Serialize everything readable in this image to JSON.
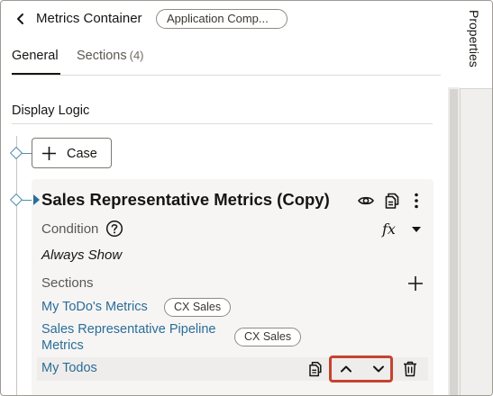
{
  "header": {
    "back_icon": "chevron-left-icon",
    "title": "Metrics Container",
    "type_badge": "Application Comp..."
  },
  "tabs": [
    {
      "label": "General",
      "selected": true
    },
    {
      "label": "Sections",
      "count": "(4)",
      "selected": false
    }
  ],
  "side_panel": {
    "tab_label": "Properties"
  },
  "display_logic": {
    "heading": "Display Logic",
    "add_case_label": "Case",
    "rule": {
      "title": "Sales Representative Metrics (Copy)",
      "actions": [
        "eye-icon",
        "copy-icon",
        "more-vertical-icon"
      ],
      "condition_label": "Condition",
      "condition_help_icon": "help-circle-icon",
      "expression_button": "fx",
      "condition_value": "Always Show",
      "sections_label": "Sections",
      "add_section_icon": "plus-icon",
      "sections": [
        {
          "name": "My ToDo's Metrics",
          "tag": "CX Sales"
        },
        {
          "name": "Sales Representative Pipeline Metrics",
          "tag": "CX Sales"
        },
        {
          "name": "My Todos",
          "tag": "",
          "row_actions": [
            "copy-icon",
            "chevron-up-icon",
            "chevron-down-icon",
            "trash-icon"
          ]
        }
      ]
    }
  },
  "colors": {
    "link": "#2a6d98",
    "highlight_border": "#c5432f",
    "connector": "#4f8fb3"
  }
}
